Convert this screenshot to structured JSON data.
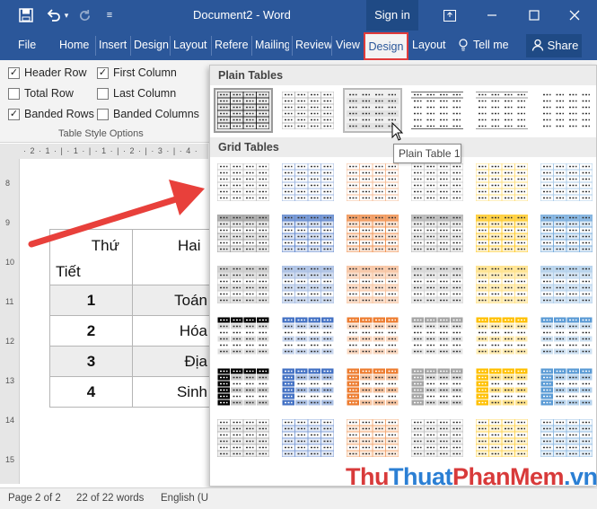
{
  "titlebar": {
    "title": "Document2  -  Word",
    "sign_in": "Sign in"
  },
  "tabs": [
    "File",
    "Home",
    "Insert",
    "Design",
    "Layout",
    "Referer",
    "Mailing",
    "Review",
    "View"
  ],
  "context_tabs": {
    "design": "Design",
    "layout": "Layout"
  },
  "tell_me": "Tell me",
  "share": "Share",
  "table_style_options": {
    "group_label": "Table Style Options",
    "options": [
      {
        "label": "Header Row",
        "checked": true
      },
      {
        "label": "First Column",
        "checked": true
      },
      {
        "label": "Total Row",
        "checked": false
      },
      {
        "label": "Last Column",
        "checked": false
      },
      {
        "label": "Banded Rows",
        "checked": true
      },
      {
        "label": "Banded Columns",
        "checked": false
      }
    ]
  },
  "ruler": {
    "h_text": "· 2 · 1 · | · 1 · | · 1 · | · 2 · | · 3 · | · 4 ·",
    "v_numbers": [
      "8",
      "9",
      "10",
      "11",
      "12",
      "13",
      "14",
      "15"
    ]
  },
  "doc_table": {
    "header": {
      "c1_line1": "Thứ",
      "c1_line2": "Tiết",
      "c2": "Hai"
    },
    "rows": [
      {
        "num": "1",
        "subject": "Toán"
      },
      {
        "num": "2",
        "subject": "Hóa"
      },
      {
        "num": "3",
        "subject": "Địa"
      },
      {
        "num": "4",
        "subject": "Sinh"
      }
    ]
  },
  "gallery": {
    "plain_tables_heading": "Plain Tables",
    "grid_tables_heading": "Grid Tables",
    "tooltip": "Plain Table 1",
    "grid_colors": [
      "#8c8c8c",
      "#4472c4",
      "#ed7d31",
      "#a5a5a5",
      "#ffc000",
      "#5b9bd5"
    ]
  },
  "statusbar": {
    "page": "Page 2 of 2",
    "words": "22 of 22 words",
    "language": "English (U"
  },
  "watermark": {
    "part1": "Thu",
    "part2": "Thuat",
    "part3": "PhanMem",
    "part4": ".vn"
  },
  "colors": {
    "accent": "#2b579a",
    "highlight_border": "#e03b3b",
    "arrow": "#e8403b"
  }
}
